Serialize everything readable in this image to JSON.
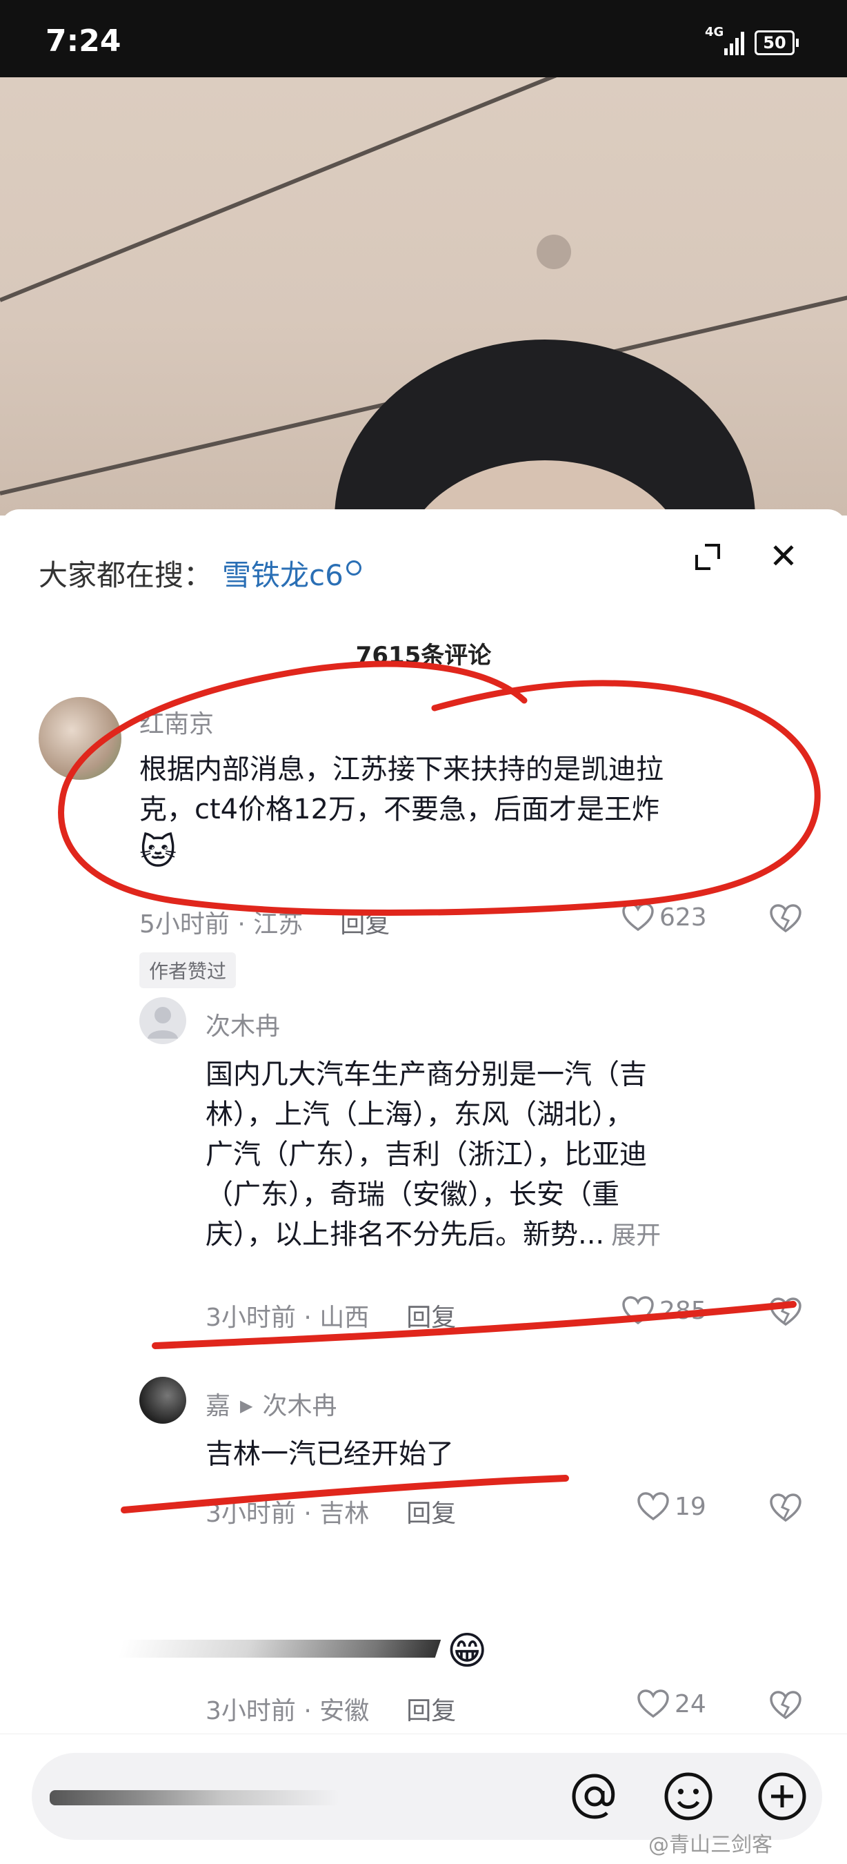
{
  "status_bar": {
    "time": "7:24",
    "network": "4G",
    "battery": "50"
  },
  "search": {
    "label": "大家都在搜：",
    "term": "雪铁龙c6"
  },
  "comments_count": "7615条评论",
  "comments": [
    {
      "user": "红南京",
      "text_line1": "根据内部消息，江苏接下来扶持的是凯迪拉",
      "text_line2": "克，ct4价格12万，不要急，后面才是王炸",
      "emoji": "🐱",
      "meta": "5小时前 · 江苏",
      "reply_label": "回复",
      "likes": "623",
      "tag": "作者赞过"
    }
  ],
  "replies": [
    {
      "user": "次木冉",
      "lines": [
        "国内几大汽车生产商分别是一汽（吉",
        "林），上汽（上海），东风（湖北），",
        "广汽（广东），吉利（浙江），比亚迪",
        "（广东），奇瑞（安徽），长安（重",
        "庆），以上排名不分先后。新势..."
      ],
      "more": "展开",
      "meta": "3小时前 · 山西",
      "reply_label": "回复",
      "likes": "285"
    },
    {
      "user": "嘉",
      "reply_to": "次木冉",
      "text": "吉林一汽已经开始了",
      "meta": "3小时前 · 吉林",
      "reply_label": "回复",
      "likes": "19"
    },
    {
      "emoji": "😁",
      "meta": "3小时前 · 安徽",
      "reply_label": "回复",
      "likes": "24"
    }
  ],
  "watermark": "@青山三剑客",
  "colors": {
    "annotation_red": "#e0261c",
    "link_blue": "#2a6fb5"
  }
}
